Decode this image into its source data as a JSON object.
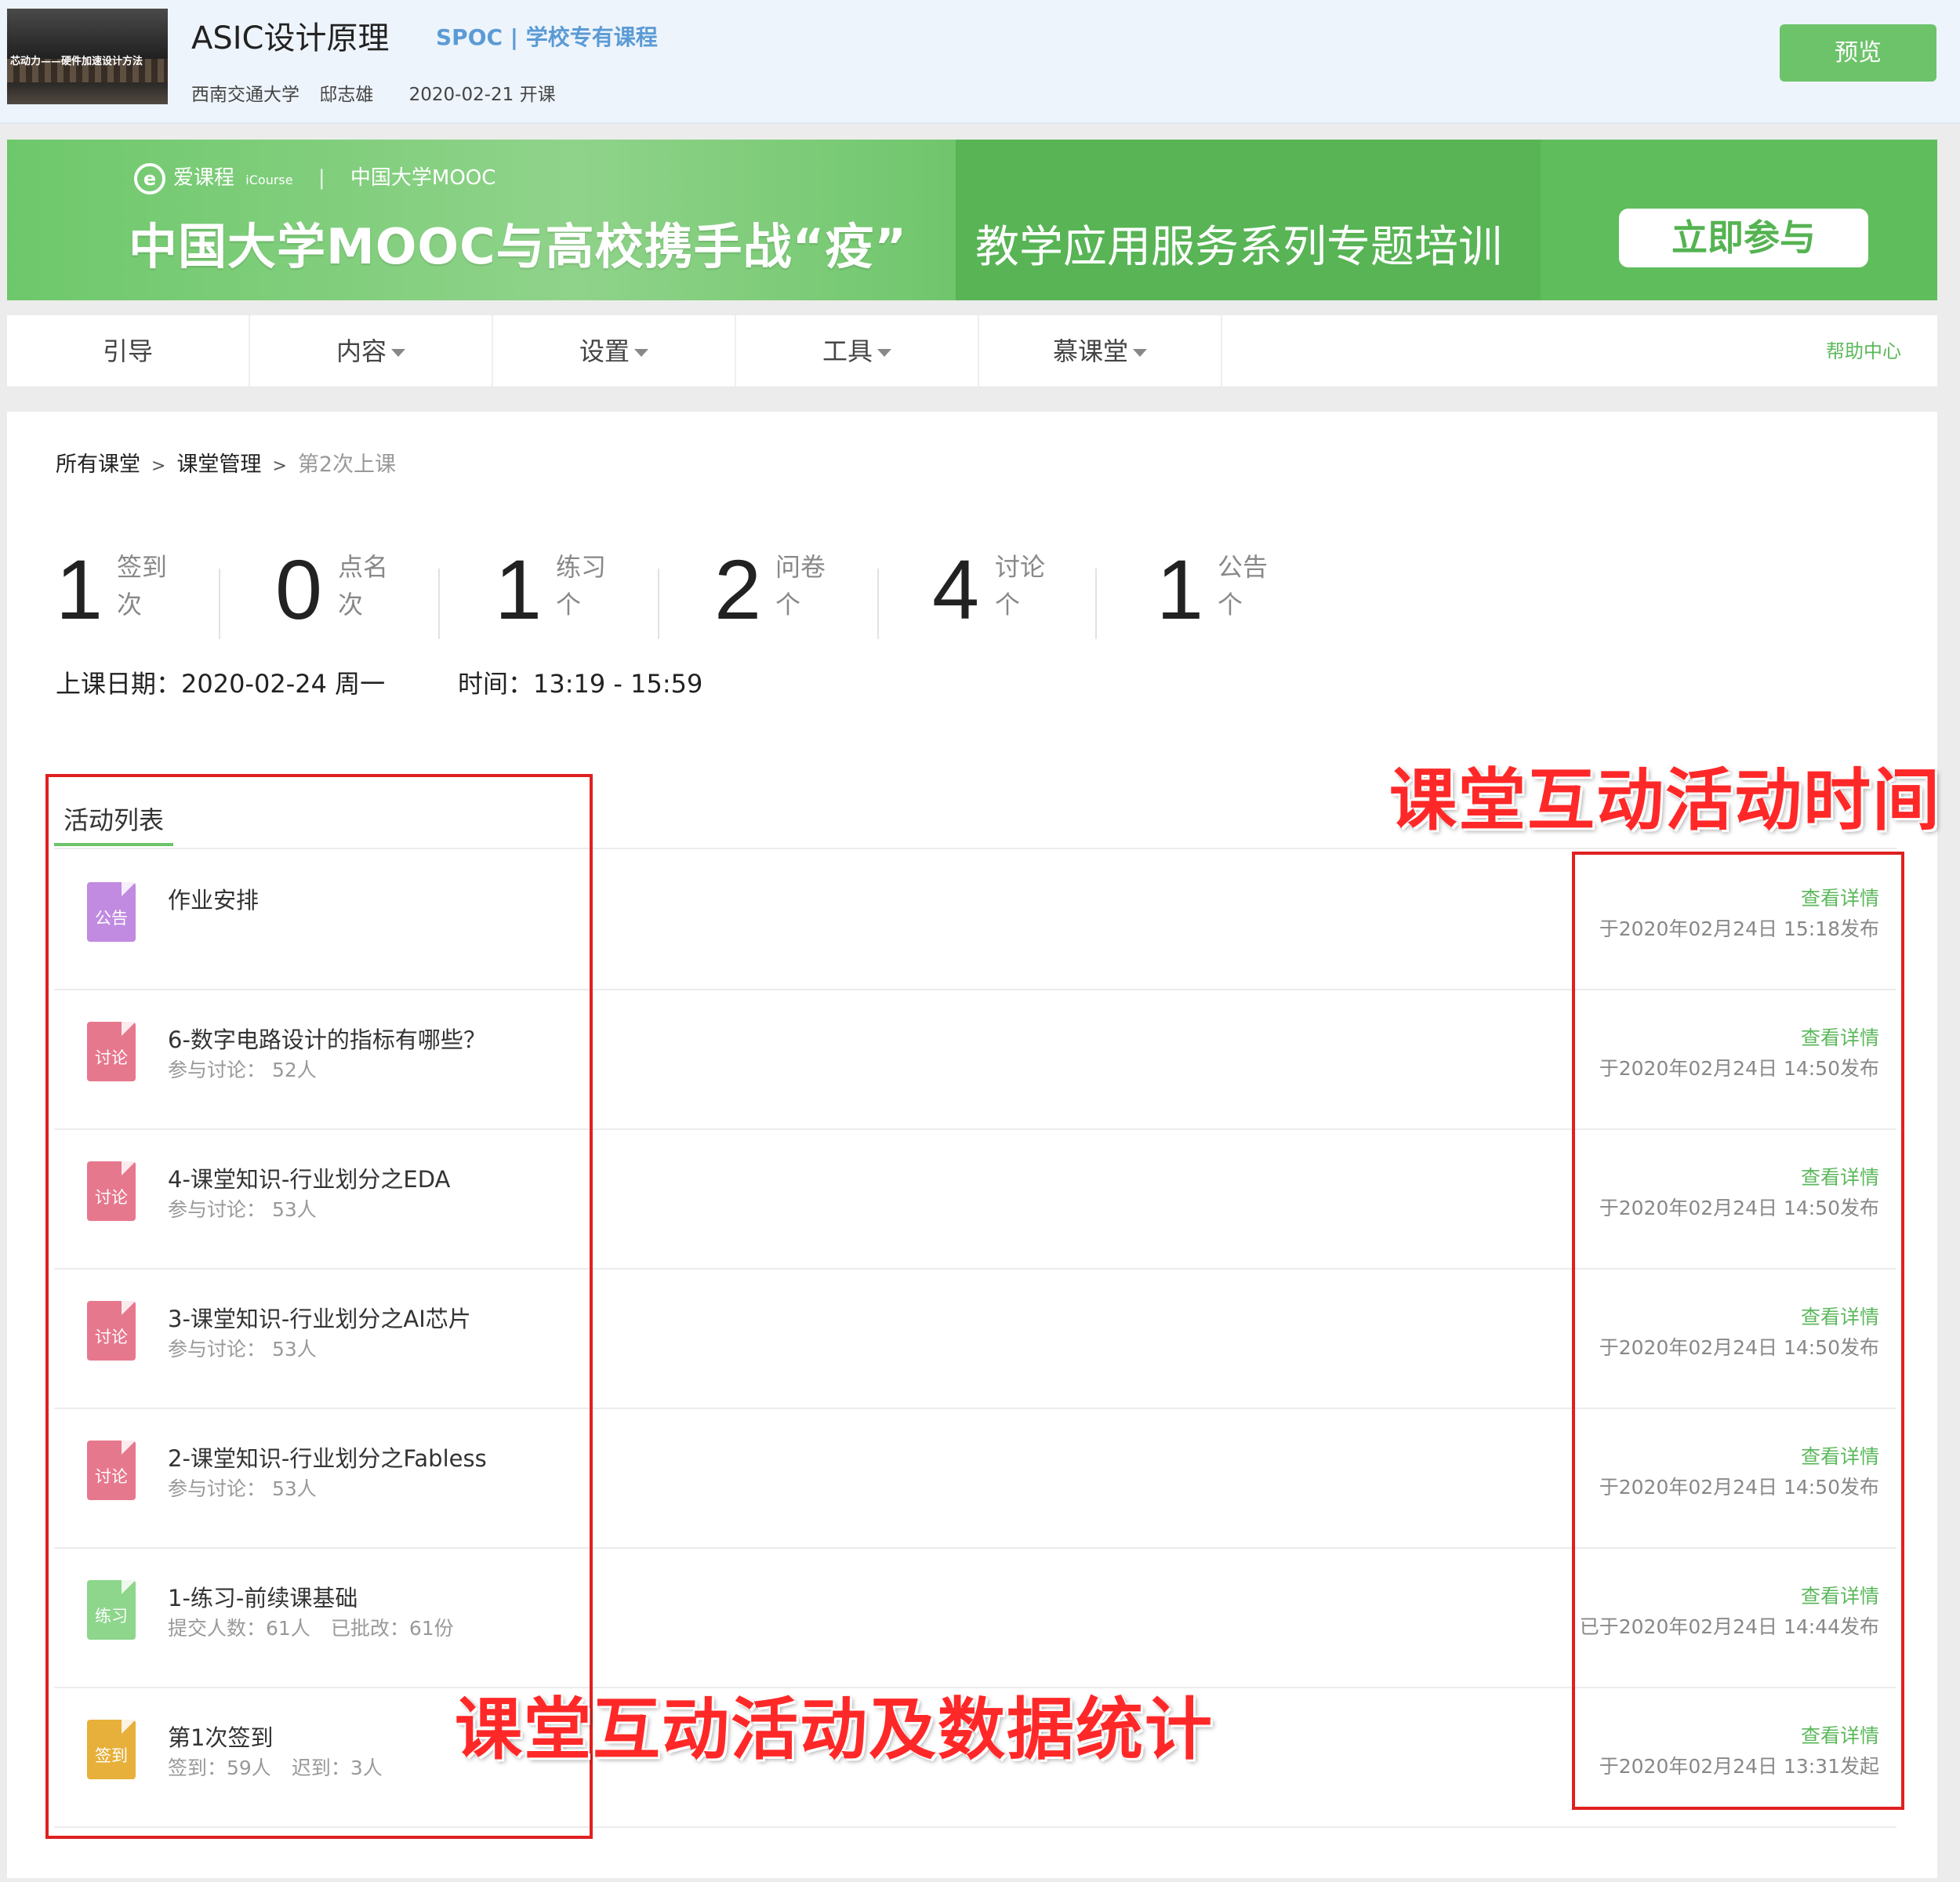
{
  "header": {
    "thumbnail_text": "芯动力——硬件加速设计方法",
    "course_title": "ASIC设计原理",
    "course_tag": "SPOC | 学校专有课程",
    "university": "西南交通大学",
    "teacher": "邸志雄",
    "start_date": "2020-02-21 开课",
    "preview_label": "预览"
  },
  "banner": {
    "logo_icourse_cn": "爱课程",
    "logo_icourse_en": "iCourse",
    "logo_mooc": "中国大学MOOC",
    "main_slogan": "中国大学MOOC与高校携手战“疫”",
    "sub_slogan": "教学应用服务系列专题培训",
    "join_label": "立即参与",
    "colors": {
      "green": "#5cbb5a",
      "light_green": "#8fd38a"
    }
  },
  "nav": {
    "items": [
      {
        "label": "引导",
        "has_dropdown": false
      },
      {
        "label": "内容",
        "has_dropdown": true
      },
      {
        "label": "设置",
        "has_dropdown": true
      },
      {
        "label": "工具",
        "has_dropdown": true
      },
      {
        "label": "慕课堂",
        "has_dropdown": true
      }
    ],
    "help": "帮助中心"
  },
  "breadcrumb": {
    "items": [
      "所有课堂",
      "课堂管理"
    ],
    "current": "第2次上课"
  },
  "stats": [
    {
      "value": "1",
      "label": "签到",
      "unit": "次"
    },
    {
      "value": "0",
      "label": "点名",
      "unit": "次"
    },
    {
      "value": "1",
      "label": "练习",
      "unit": "个"
    },
    {
      "value": "2",
      "label": "问卷",
      "unit": "个"
    },
    {
      "value": "4",
      "label": "讨论",
      "unit": "个"
    },
    {
      "value": "1",
      "label": "公告",
      "unit": "个"
    }
  ],
  "class_info": {
    "date_label": "上课日期：",
    "date_value": "2020-02-24 周一",
    "time_label": "时间：",
    "time_value": "13:19 - 15:59"
  },
  "activity_tab": "活动列表",
  "activities": [
    {
      "type": "公告",
      "type_color": "#c08be0",
      "title": "作业安排",
      "meta": [],
      "link": "查看详情",
      "time": "于2020年02月24日 15:18发布"
    },
    {
      "type": "讨论",
      "type_color": "#e6788e",
      "title": "6-数字电路设计的指标有哪些？",
      "meta": [
        "参与讨论：  52人"
      ],
      "link": "查看详情",
      "time": "于2020年02月24日 14:50发布"
    },
    {
      "type": "讨论",
      "type_color": "#e6788e",
      "title": "4-课堂知识-行业划分之EDA",
      "meta": [
        "参与讨论：  53人"
      ],
      "link": "查看详情",
      "time": "于2020年02月24日 14:50发布"
    },
    {
      "type": "讨论",
      "type_color": "#e6788e",
      "title": "3-课堂知识-行业划分之AI芯片",
      "meta": [
        "参与讨论：  53人"
      ],
      "link": "查看详情",
      "time": "于2020年02月24日 14:50发布"
    },
    {
      "type": "讨论",
      "type_color": "#e6788e",
      "title": "2-课堂知识-行业划分之Fabless",
      "meta": [
        "参与讨论：  53人"
      ],
      "link": "查看详情",
      "time": "于2020年02月24日 14:50发布"
    },
    {
      "type": "练习",
      "type_color": "#8dd68b",
      "title": "1-练习-前续课基础",
      "meta": [
        "提交人数：61人",
        "已批改：61份"
      ],
      "link": "查看详情",
      "time": "已于2020年02月24日 14:44发布"
    },
    {
      "type": "签到",
      "type_color": "#e6b03a",
      "title": "第1次签到",
      "meta": [
        "签到：59人",
        "迟到：3人"
      ],
      "link": "查看详情",
      "time": "于2020年02月24日 13:31发起"
    }
  ],
  "annotations": {
    "time_label": "课堂互动活动时间",
    "stats_label": "课堂互动活动及数据统计",
    "color": "#e02020"
  }
}
